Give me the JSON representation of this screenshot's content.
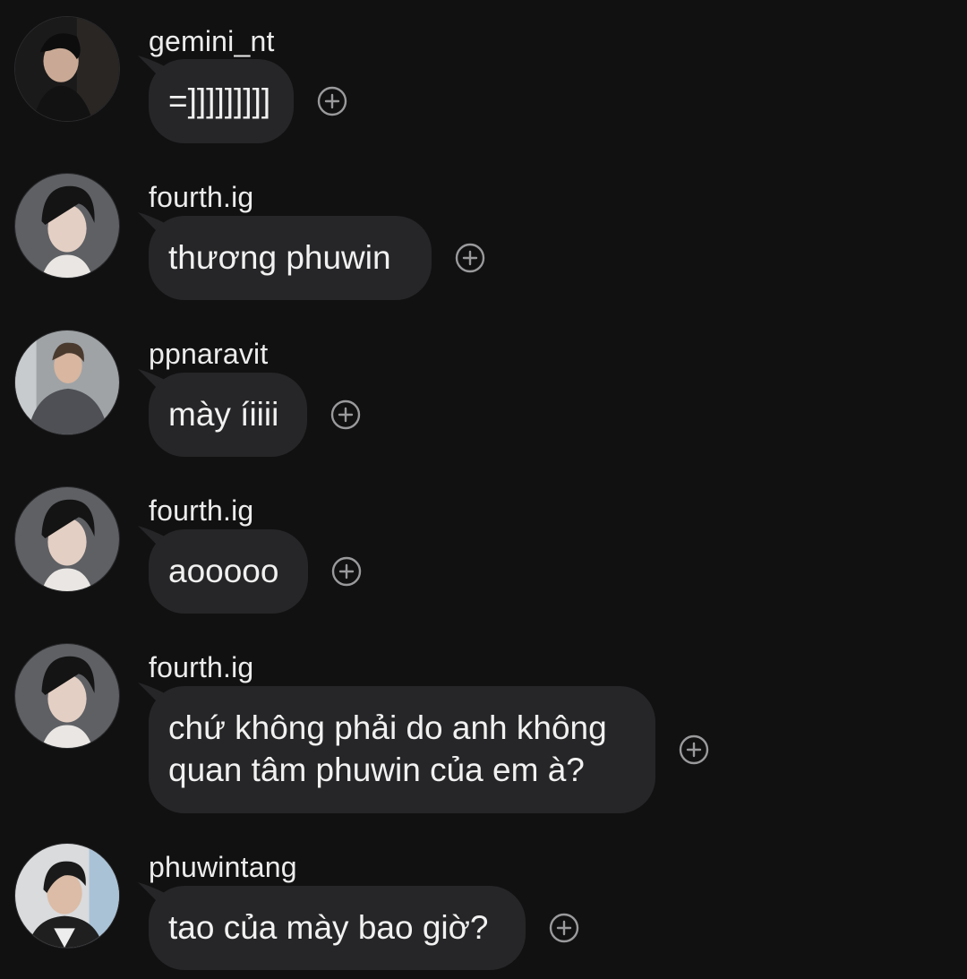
{
  "messages": [
    {
      "username": "gemini_nt",
      "lines": [
        "=]]]]]]]]]"
      ]
    },
    {
      "username": "fourth.ig",
      "lines": [
        "thương phuwin"
      ]
    },
    {
      "username": "ppnaravit",
      "lines": [
        "mày íiiii"
      ]
    },
    {
      "username": "fourth.ig",
      "lines": [
        "aooooo"
      ]
    },
    {
      "username": "fourth.ig",
      "lines": [
        "chứ không phải do anh không",
        "quan tâm phuwin của em à?"
      ]
    },
    {
      "username": "phuwintang",
      "lines": [
        "tao của mày bao giờ?"
      ]
    }
  ],
  "icons": {
    "avatar": "profile-photo",
    "react": "add-reaction-plus-icon"
  },
  "colors": {
    "background": "#111112",
    "bubble": "#262628",
    "text": "#f1f1f1",
    "icon": "#9a9a9c"
  }
}
